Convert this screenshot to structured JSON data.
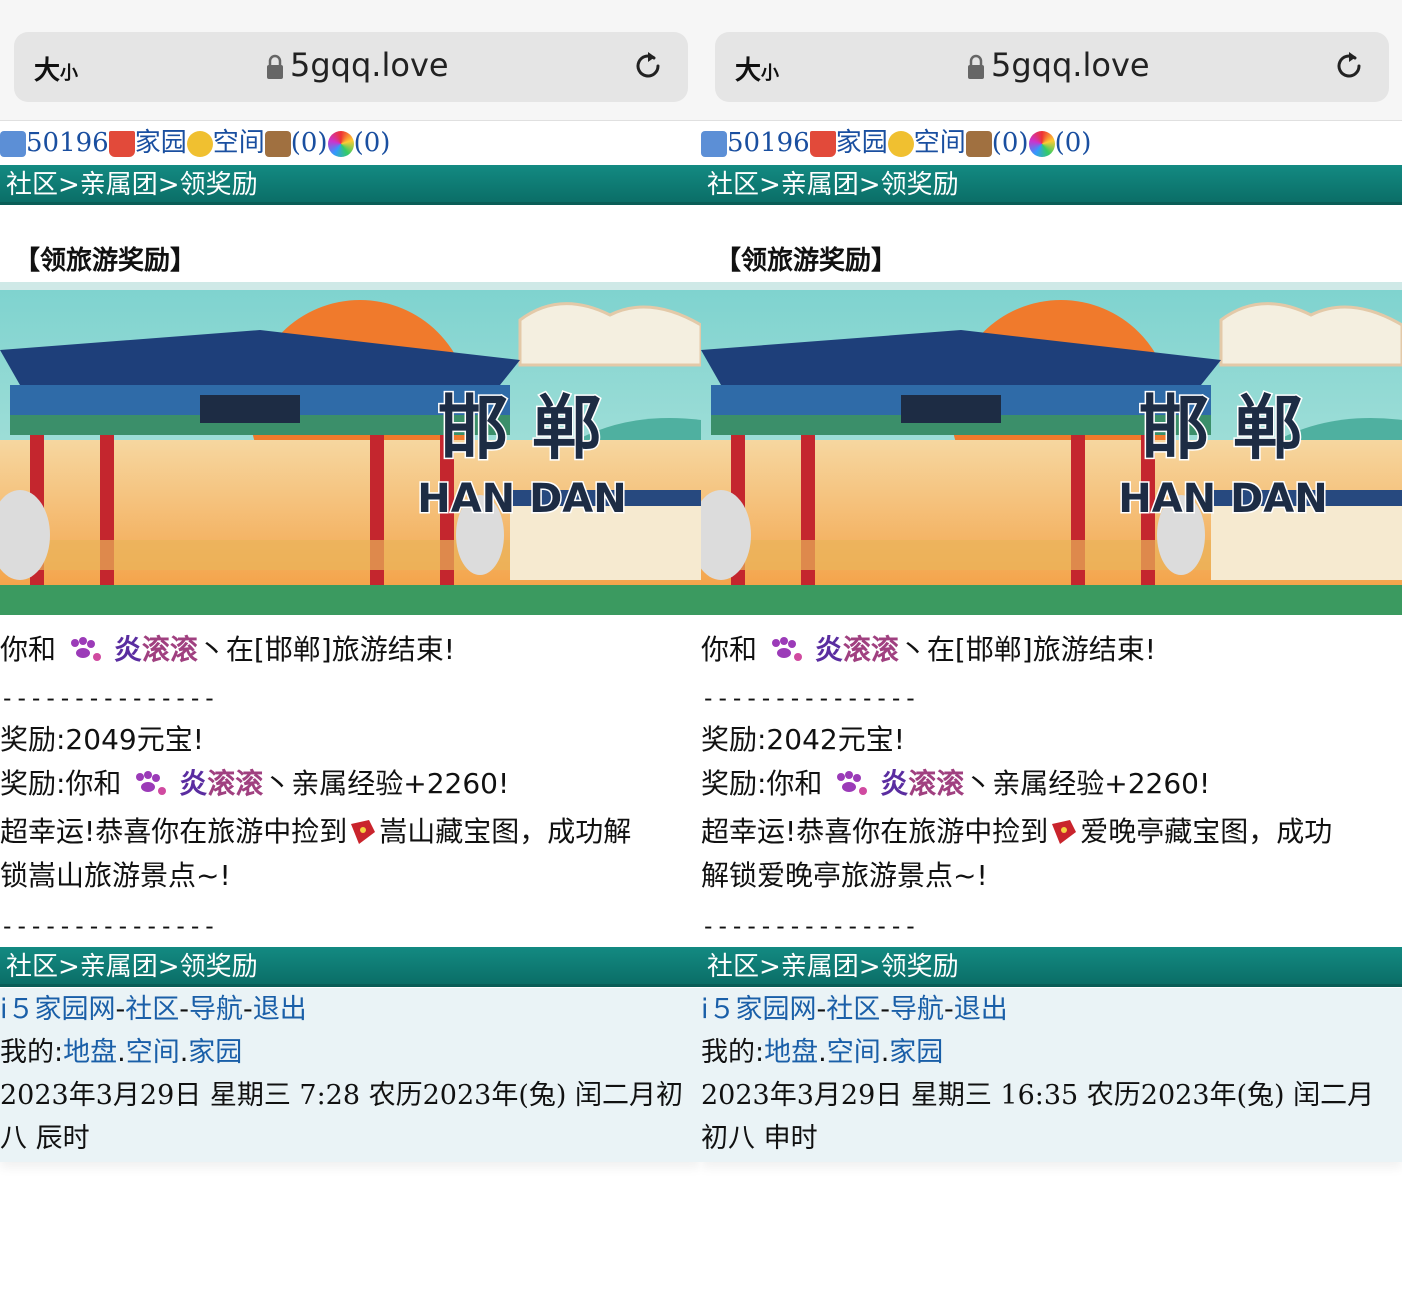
{
  "browser": {
    "text_size_big": "大",
    "text_size_small": "小",
    "url": "5gqq.love"
  },
  "topline": {
    "user_id": "50196",
    "home": "家园",
    "space": "空间",
    "count1": "(0)",
    "count2": "(0)"
  },
  "breadcrumb": "社区>亲属团>领奖励",
  "section_title": "【领旅游奖励】",
  "banner": {
    "city_cn": "邯 郸",
    "city_en": "HAN DAN"
  },
  "panels": [
    {
      "line1_prefix": "你和",
      "name_a": "炎",
      "name_b": "滚滚",
      "line1_suffix": "丶在[邯郸]旅游结束!",
      "dashes": "---------------",
      "reward1": "奖励:2049元宝!",
      "reward2_prefix": "奖励:你和",
      "reward2_suffix": "丶亲属经验+2260!",
      "lucky_prefix": "超幸运!恭喜你在旅游中捡到",
      "lucky_line1": "嵩山藏宝图，成功解",
      "lucky_line2": "锁嵩山旅游景点~!",
      "footer_site": "i５家园网",
      "footer_community": "社区",
      "footer_nav": "导航",
      "footer_exit": "退出",
      "footer_mine": "我的:",
      "footer_land": "地盘",
      "footer_space": "空间",
      "footer_home": "家园",
      "date_line1": "2023年3月29日  星期三  7:28  农历2023年(兔)  闰二月初",
      "date_line2": "八  辰时"
    },
    {
      "line1_prefix": "你和",
      "name_a": "炎",
      "name_b": "滚滚",
      "line1_suffix": "丶在[邯郸]旅游结束!",
      "dashes": "---------------",
      "reward1": "奖励:2042元宝!",
      "reward2_prefix": "奖励:你和",
      "reward2_suffix": "丶亲属经验+2260!",
      "lucky_prefix": "超幸运!恭喜你在旅游中捡到",
      "lucky_line1": "爱晚亭藏宝图，成功",
      "lucky_line2": "解锁爱晚亭旅游景点~!",
      "footer_site": "i５家园网",
      "footer_community": "社区",
      "footer_nav": "导航",
      "footer_exit": "退出",
      "footer_mine": "我的:",
      "footer_land": "地盘",
      "footer_space": "空间",
      "footer_home": "家园",
      "date_line1": "2023年3月29日  星期三  16:35  农历2023年(兔)  闰二月",
      "date_line2": "初八  申时"
    }
  ],
  "colors": {
    "teal": "#0e7a73",
    "link": "#1a5fa8",
    "purple": "#5a2da0"
  }
}
